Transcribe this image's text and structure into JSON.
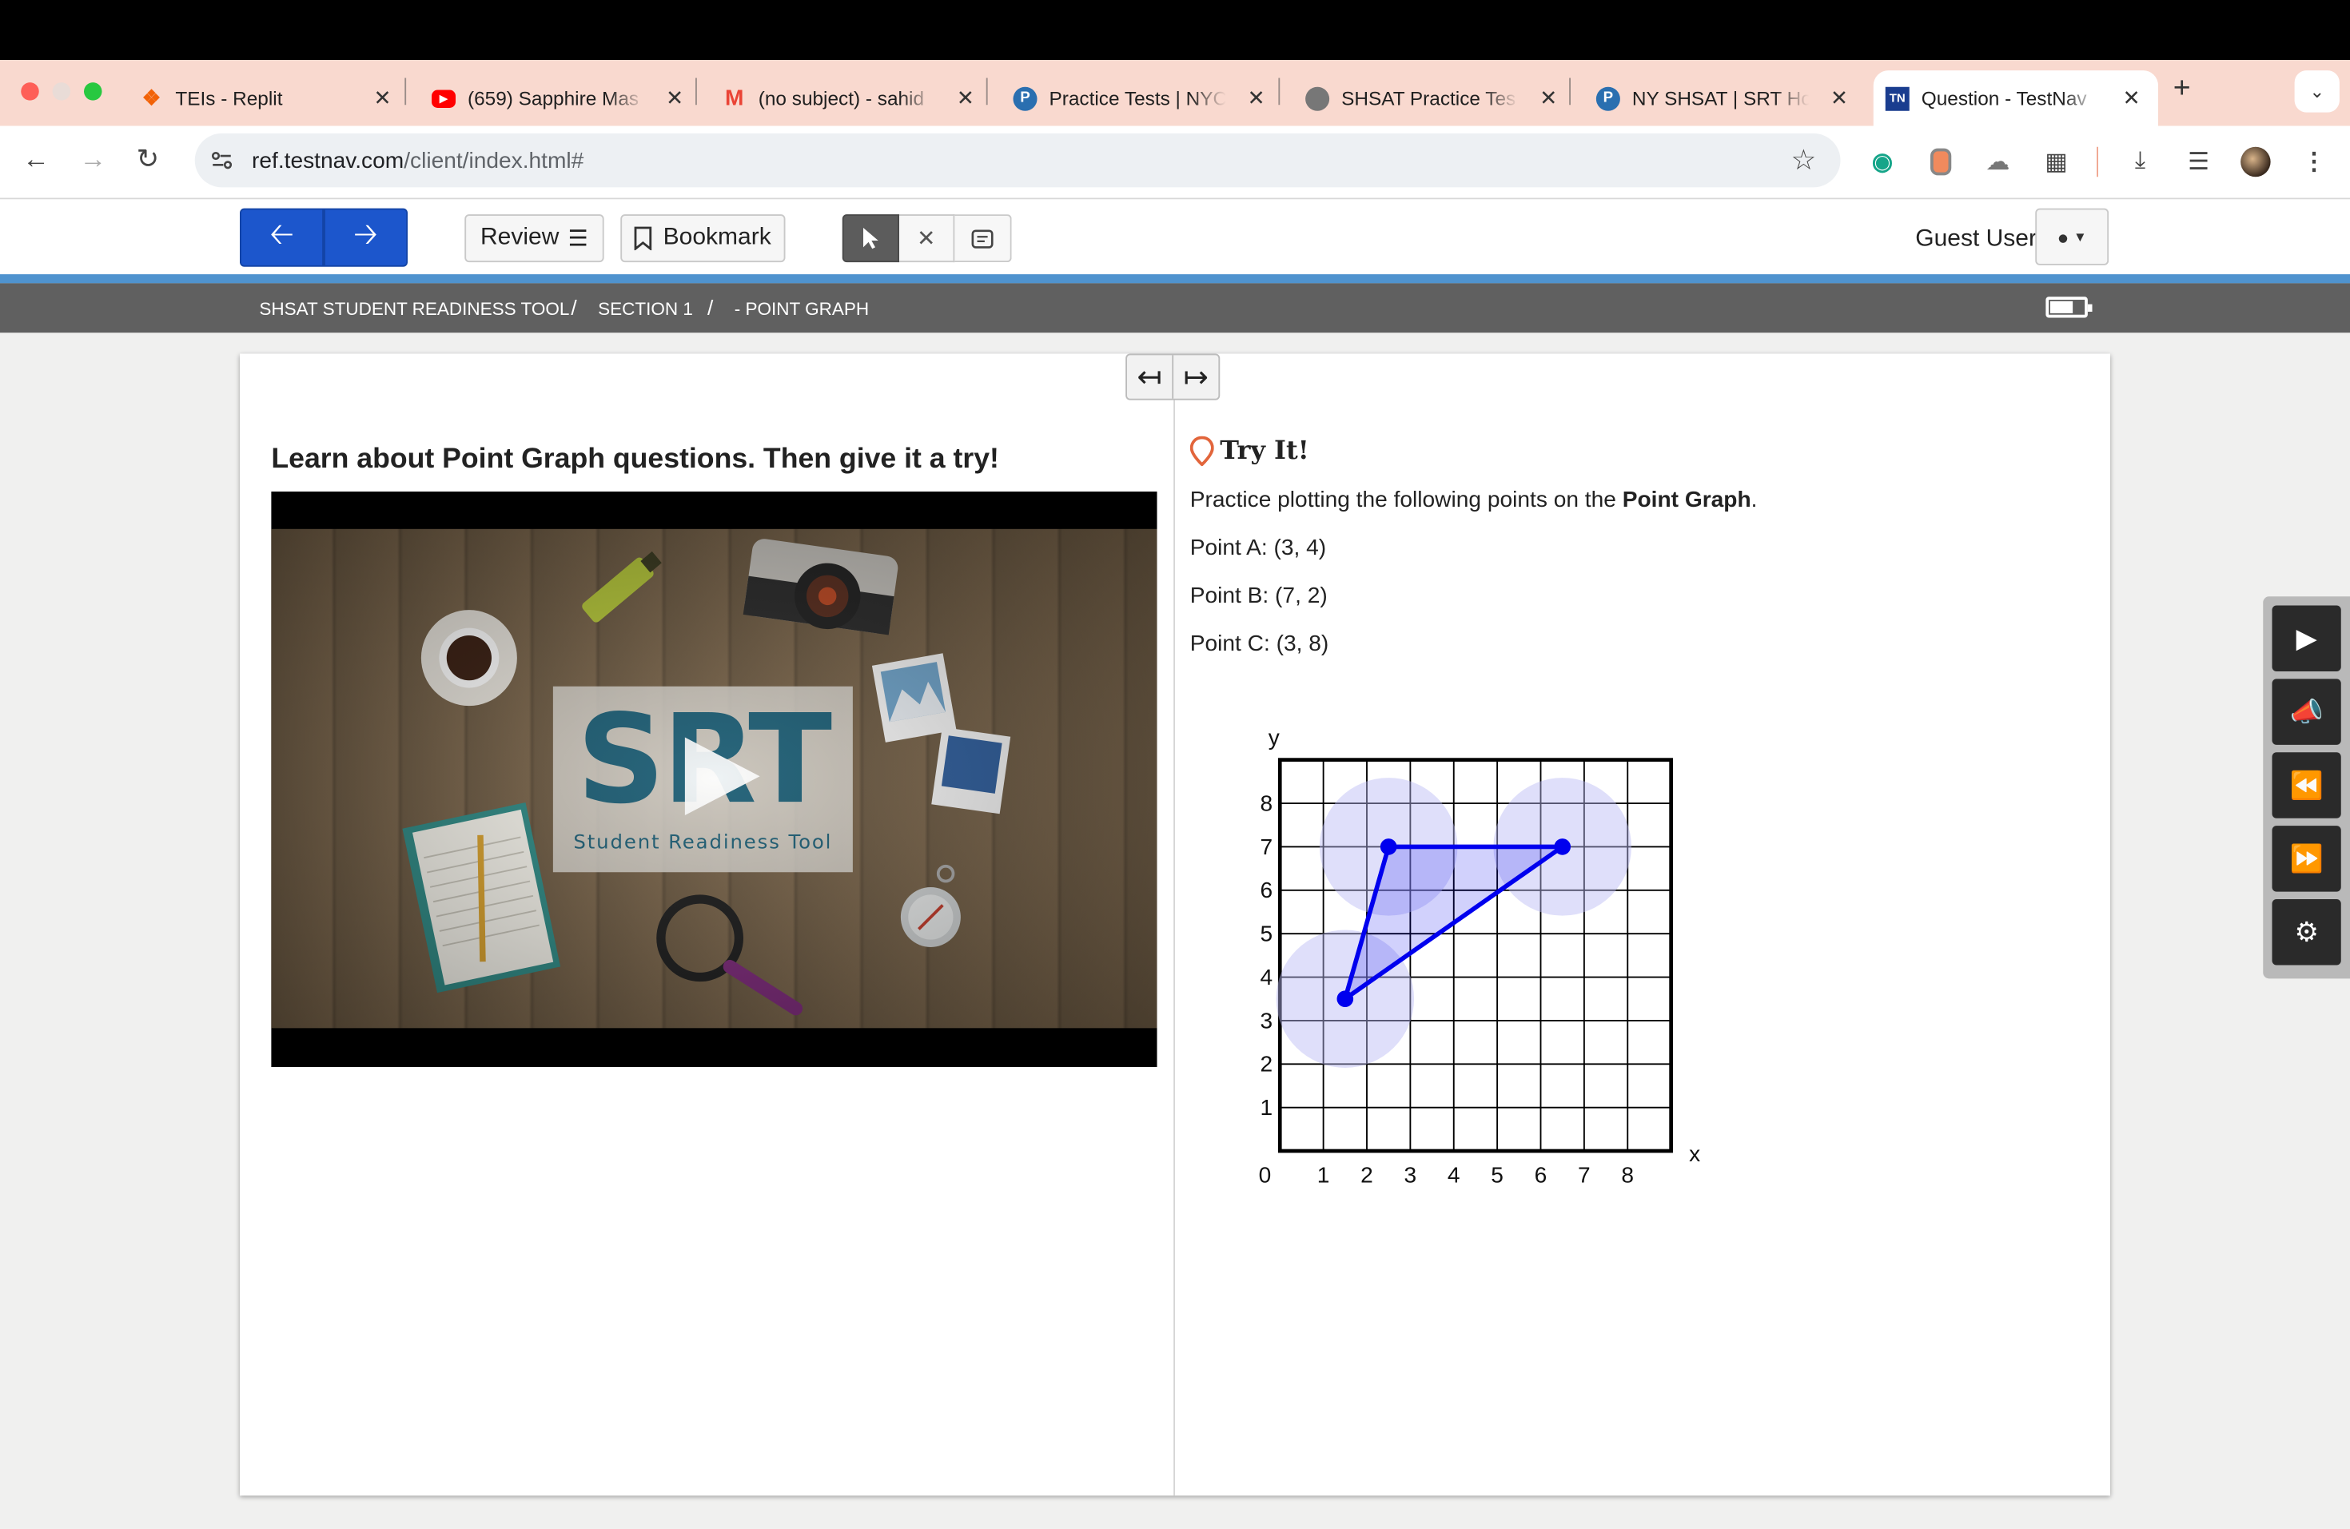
{
  "browser": {
    "tabs": [
      {
        "title": "TEIs - Replit",
        "icon": "replit-icon",
        "color": "#f26207"
      },
      {
        "title": "(659) Sapphire Mas",
        "icon": "youtube-icon",
        "color": "#ff0000"
      },
      {
        "title": "(no subject) - sahid",
        "icon": "gmail-icon",
        "color": "#ea4335"
      },
      {
        "title": "Practice Tests | NYC",
        "icon": "p-icon",
        "color": "#2a6fb0"
      },
      {
        "title": "SHSAT Practice Tes",
        "icon": "globe-icon",
        "color": "#777777"
      },
      {
        "title": "NY SHSAT | SRT Ho",
        "icon": "p-icon",
        "color": "#2a6fb0"
      },
      {
        "title": "Question - TestNav",
        "icon": "testnav-icon",
        "color": "#1a3d8f",
        "active": true
      }
    ],
    "url_main": "ref.testnav.com",
    "url_path": "/client/index.html#"
  },
  "toolbar": {
    "review_label": "Review",
    "bookmark_label": "Bookmark",
    "guest_label": "Guest User"
  },
  "breadcrumb": {
    "part1": "SHSAT STUDENT READINESS TOOL",
    "sep": "/",
    "part2": "SECTION 1",
    "part3": "- POINT GRAPH"
  },
  "left": {
    "title": "Learn about Point Graph questions. Then give it a try!",
    "video_logo": "SRT",
    "video_caption": "Student Readiness Tool"
  },
  "right": {
    "try_title": "Try It!",
    "instruction_pre": "Practice plotting the following points on the ",
    "instruction_bold": "Point Graph",
    "instruction_post": ".",
    "points": [
      "Point A: (3, 4)",
      "Point B: (7, 2)",
      "Point C: (3, 8)"
    ]
  },
  "chart_data": {
    "type": "scatter",
    "xlabel": "x",
    "ylabel": "y",
    "xlim": [
      0,
      9
    ],
    "ylim": [
      0,
      9
    ],
    "x_ticks": [
      "0",
      "1",
      "2",
      "3",
      "4",
      "5",
      "6",
      "7",
      "8"
    ],
    "y_ticks": [
      "1",
      "2",
      "3",
      "4",
      "5",
      "6",
      "7",
      "8"
    ],
    "plotted_points": [
      {
        "x": 1.5,
        "y": 3.5
      },
      {
        "x": 2.5,
        "y": 7
      },
      {
        "x": 6.5,
        "y": 7
      }
    ],
    "polygon_closed": true,
    "point_color": "#0000ee",
    "highlight_color": "#b8b8f5",
    "grid": true
  },
  "battery_level": 0.7,
  "colors": {
    "nav_blue": "#1c56cc",
    "tabstrip": "#f9d9cf",
    "crumbbar": "#606060",
    "accent_line": "#4f93cf"
  }
}
